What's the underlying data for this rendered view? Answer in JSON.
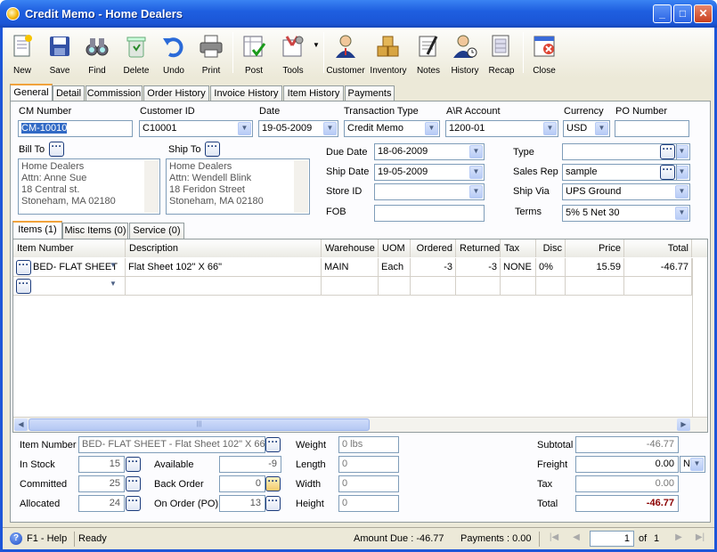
{
  "window": {
    "title": "Credit Memo - Home Dealers",
    "minimize": "_",
    "maximize": "□",
    "close": "✕"
  },
  "toolbar": [
    {
      "name": "new",
      "label": "New"
    },
    {
      "name": "save",
      "label": "Save"
    },
    {
      "name": "find",
      "label": "Find"
    },
    {
      "name": "delete",
      "label": "Delete"
    },
    {
      "name": "undo",
      "label": "Undo"
    },
    {
      "name": "print",
      "label": "Print"
    },
    {
      "name": "post",
      "label": "Post"
    },
    {
      "name": "tools",
      "label": "Tools"
    },
    {
      "name": "customer",
      "label": "Customer"
    },
    {
      "name": "inventory",
      "label": "Inventory"
    },
    {
      "name": "notes",
      "label": "Notes"
    },
    {
      "name": "history",
      "label": "History"
    },
    {
      "name": "recap",
      "label": "Recap"
    },
    {
      "name": "close",
      "label": "Close"
    }
  ],
  "tabs": [
    "General",
    "Detail",
    "Commission",
    "Order History",
    "Invoice History",
    "Item History",
    "Payments"
  ],
  "header": {
    "cm_number_label": "CM Number",
    "cm_number": "CM-10010",
    "customer_id_label": "Customer ID",
    "customer_id": "C10001",
    "date_label": "Date",
    "date": "19-05-2009",
    "transaction_type_label": "Transaction Type",
    "transaction_type": "Credit Memo",
    "ar_account_label": "A\\R Account",
    "ar_account": "1200-01",
    "currency_label": "Currency",
    "currency": "USD",
    "po_number_label": "PO Number",
    "po_number": ""
  },
  "bill_to": {
    "label": "Bill To",
    "lines": [
      "Home Dealers",
      "Attn: Anne Sue",
      "18 Central st.",
      "Stoneham, MA 02180"
    ]
  },
  "ship_to": {
    "label": "Ship To",
    "lines": [
      "Home Dealers",
      "Attn: Wendell Blink",
      "18 Feridon Street",
      "Stoneham, MA 02180"
    ]
  },
  "dates": {
    "due_date_label": "Due Date",
    "due_date": "18-06-2009",
    "ship_date_label": "Ship Date",
    "ship_date": "19-05-2009",
    "store_id_label": "Store ID",
    "store_id": "",
    "fob_label": "FOB",
    "fob": ""
  },
  "right_fields": {
    "type_label": "Type",
    "type": "",
    "sales_rep_label": "Sales Rep",
    "sales_rep": "sample",
    "ship_via_label": "Ship Via",
    "ship_via": "UPS Ground",
    "terms_label": "Terms",
    "terms": "5% 5 Net 30"
  },
  "subtabs": [
    "Items (1)",
    "Misc Items (0)",
    "Service (0)"
  ],
  "grid": {
    "columns": [
      "Item Number",
      "Description",
      "Warehouse",
      "UOM",
      "Ordered",
      "Returned",
      "Tax",
      "Disc",
      "Price",
      "Total"
    ],
    "rows": [
      {
        "item": "BED- FLAT SHEET",
        "description": "Flat Sheet 102\" X 66\"",
        "warehouse": "MAIN",
        "uom": "Each",
        "ordered": "-3",
        "returned": "-3",
        "tax": "NONE",
        "disc": "0%",
        "price": "15.59",
        "total": "-46.77"
      }
    ]
  },
  "item_details": {
    "item_number_label": "Item Number",
    "item_number": "BED- FLAT SHEET - Flat Sheet 102\" X 66\"",
    "in_stock_label": "In Stock",
    "in_stock": "15",
    "committed_label": "Committed",
    "committed": "25",
    "allocated_label": "Allocated",
    "allocated": "24",
    "available_label": "Available",
    "available": "-9",
    "back_order_label": "Back Order",
    "back_order": "0",
    "on_order_label": "On Order (PO)",
    "on_order": "13",
    "weight_label": "Weight",
    "weight": "0 lbs",
    "length_label": "Length",
    "length": "0",
    "width_label": "Width",
    "width": "0",
    "height_label": "Height",
    "height": "0"
  },
  "totals": {
    "subtotal_label": "Subtotal",
    "subtotal": "-46.77",
    "freight_label": "Freight",
    "freight": "0.00",
    "freight_code": "N",
    "tax_label": "Tax",
    "tax": "0.00",
    "total_label": "Total",
    "total": "-46.77"
  },
  "status": {
    "help": "F1 - Help",
    "state": "Ready",
    "amount_due": "Amount Due : -46.77",
    "payments": "Payments : 0.00",
    "page": "1",
    "of": "of",
    "pages": "1"
  },
  "colors": {
    "total_red": "#8b0000",
    "accent_tab": "#f1a23b",
    "title_blue": "#1f5fe0"
  }
}
